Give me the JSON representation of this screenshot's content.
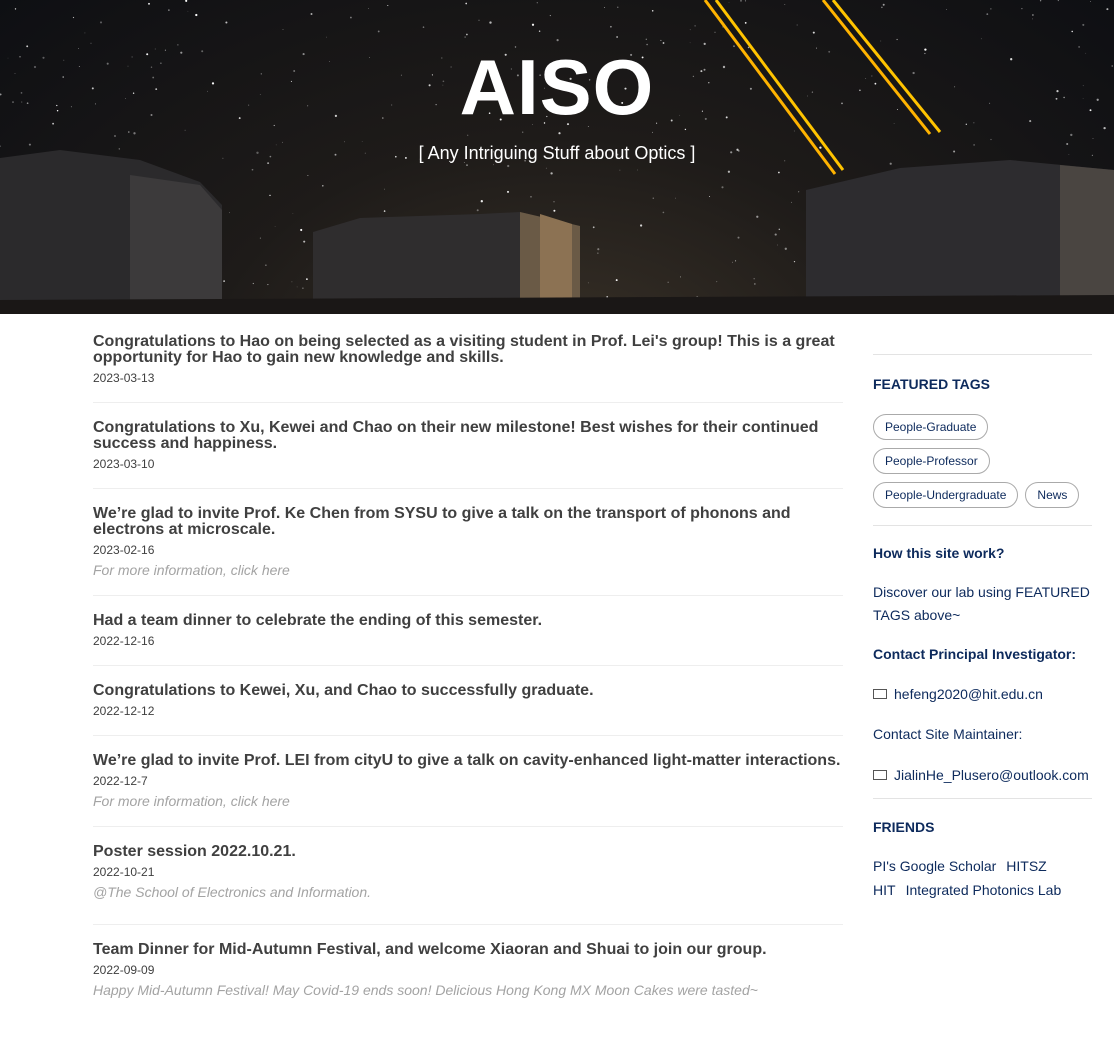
{
  "hero": {
    "title": "AISO",
    "subtitle": "[ Any Intriguing Stuff about Optics ]"
  },
  "posts": [
    {
      "title": "Congratulations to Hao on being selected as a visiting student in Prof. Lei's group! This is a great opportunity for Hao to gain new knowledge and skills.",
      "date": "2023-03-13",
      "subtitle": ""
    },
    {
      "title": "Congratulations to Xu, Kewei and Chao on their new milestone! Best wishes for their continued success and happiness.",
      "date": "2023-03-10",
      "subtitle": ""
    },
    {
      "title": "We’re glad to invite Prof. Ke Chen from SYSU to give a talk on the transport of phonons and electrons at microscale.",
      "date": "2023-02-16",
      "subtitle": "For more information, click here"
    },
    {
      "title": "Had a team dinner to celebrate the ending of this semester.",
      "date": "2022-12-16",
      "subtitle": ""
    },
    {
      "title": "Congratulations to Kewei, Xu, and Chao to successfully graduate.",
      "date": "2022-12-12",
      "subtitle": ""
    },
    {
      "title": "We’re glad to invite Prof. LEI from cityU to give a talk on cavity-enhanced light-matter interactions.",
      "date": "2022-12-7",
      "subtitle": "For more information, click here"
    },
    {
      "title": "Poster session 2022.10.21.",
      "date": "2022-10-21",
      "subtitle": "@The School of Electronics and Information."
    },
    {
      "title": "Team Dinner for Mid-Autumn Festival, and welcome Xiaoran and Shuai to join our group.",
      "date": "2022-09-09",
      "subtitle": "Happy Mid-Autumn Festival! May Covid-19 ends soon! Delicious Hong Kong MX Moon Cakes were tasted~"
    }
  ],
  "sidebar": {
    "featured_tags_heading": "FEATURED TAGS",
    "tags": [
      "People-Graduate",
      "People-Professor",
      "People-Undergraduate",
      "News"
    ],
    "how_heading": "How this site work?",
    "how_text": "Discover our lab using FEATURED TAGS above~",
    "pi_heading": "Contact Principal Investigator:",
    "pi_email": "hefeng2020@hit.edu.cn",
    "maintainer_label": "Contact Site Maintainer:",
    "maintainer_email": "JialinHe_Plusero@outlook.com",
    "friends_heading": "FRIENDS",
    "friends": [
      "PI's Google Scholar",
      "HITSZ",
      "HIT",
      "Integrated Photonics Lab"
    ]
  },
  "colors": {
    "heading_navy": "#0d2a5c",
    "laser": "#ffb300",
    "muted": "#a3a3a3"
  }
}
